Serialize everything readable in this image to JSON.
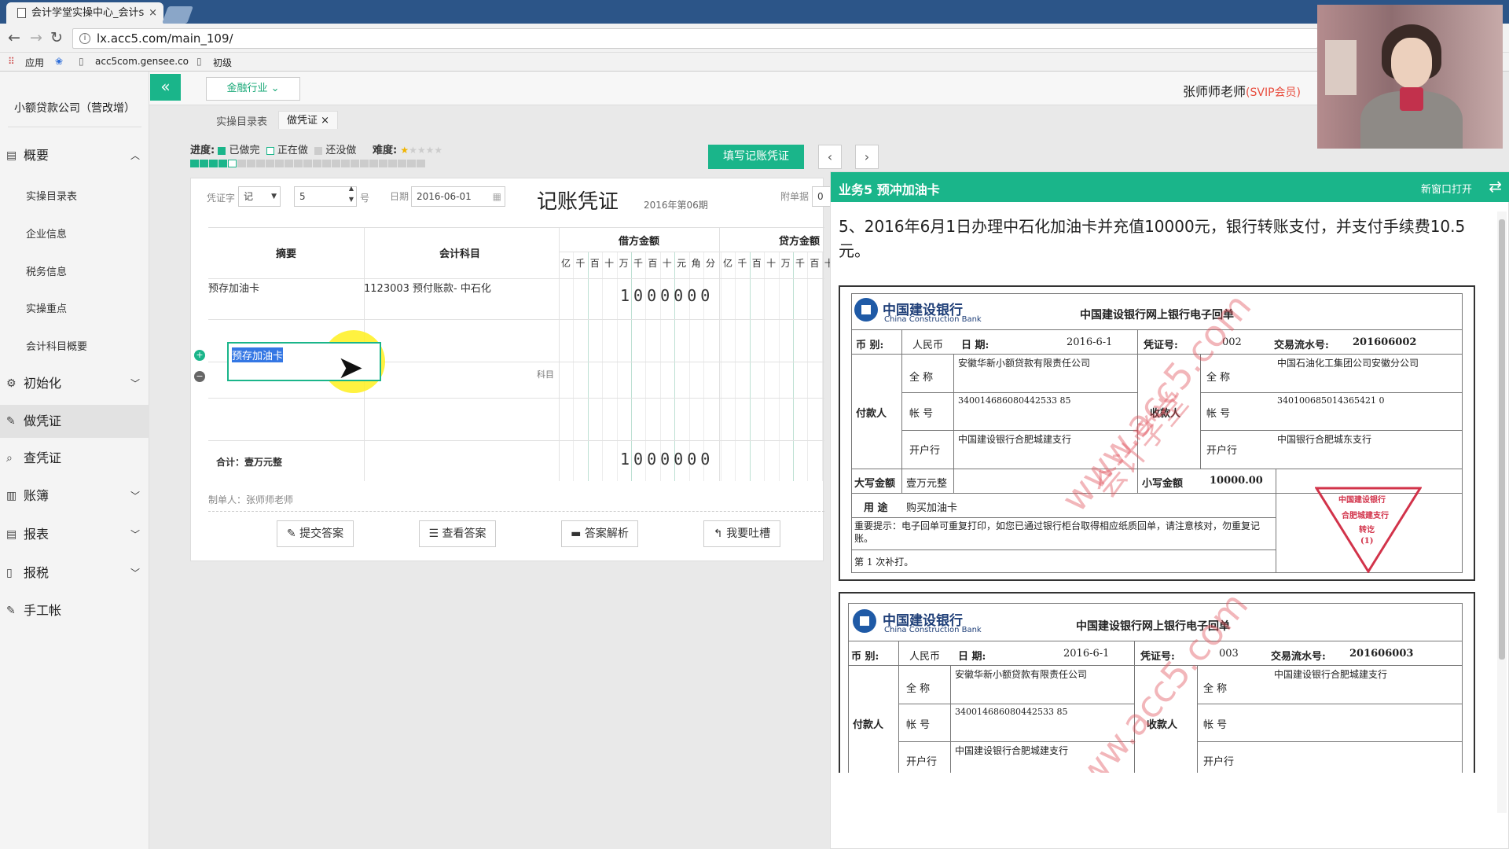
{
  "browser": {
    "tab_title": "会计学堂实操中心_会计s",
    "close": "×",
    "url": "lx.acc5.com/main_109/",
    "bookmarks": [
      "应用",
      "acc5com.gensee.co",
      "初级"
    ]
  },
  "sidebar": {
    "company": "小额贷款公司（营改增）",
    "menu": [
      {
        "label": "概要",
        "icon": "overview-icon"
      },
      {
        "label": "初始化",
        "icon": "gear-icon"
      },
      {
        "label": "做凭证",
        "icon": "pencil-icon"
      },
      {
        "label": "查凭证",
        "icon": "search-icon"
      },
      {
        "label": "账簿",
        "icon": "book-icon"
      },
      {
        "label": "报表",
        "icon": "report-icon"
      },
      {
        "label": "报税",
        "icon": "file-icon"
      },
      {
        "label": "手工帐",
        "icon": "pencil-icon"
      }
    ],
    "sub_items": [
      "实操目录表",
      "企业信息",
      "税务信息",
      "实操重点",
      "会计科目概要"
    ]
  },
  "header": {
    "industry": "金融行业",
    "teacher": "张师师老师",
    "svip": "(SVIP会员)",
    "tabs": [
      "实操目录表",
      "做凭证"
    ],
    "tab_close": "×"
  },
  "progress": {
    "label": "进度:",
    "done": "已做完",
    "doing": "正在做",
    "todo": "还没做",
    "difficulty": "难度:",
    "fill_button": "填写记账凭证",
    "prev": "‹",
    "next": "›"
  },
  "voucher": {
    "word_label": "凭证字",
    "word_value": "记",
    "num_value": "5",
    "num_suffix": "号",
    "date_label": "日期",
    "date_value": "2016-06-01",
    "title": "记账凭证",
    "period": "2016年第06期",
    "attach_label": "附单据",
    "attach_value": "0",
    "col_summary": "摘要",
    "col_account": "会计科目",
    "col_debit": "借方金额",
    "col_credit": "贷方金额",
    "digits": [
      "亿",
      "千",
      "百",
      "十",
      "万",
      "千",
      "百",
      "十",
      "元",
      "角",
      "分"
    ],
    "credit_digits": [
      "亿",
      "千",
      "百",
      "十",
      "万",
      "千",
      "百",
      "十"
    ],
    "row1_summary": "预存加油卡",
    "row1_account": "1123003 预付账款- 中石化",
    "row1_debit": "1000000",
    "row2_editing": "预存加油卡",
    "row2_account_hint": "科目",
    "total_label": "合计：壹万元整",
    "total_debit": "1000000",
    "preparer": "制单人：张师师老师",
    "buttons": [
      "提交答案",
      "查看答案",
      "答案解析",
      "我要吐槽"
    ]
  },
  "task": {
    "title": "业务5 预冲加油卡",
    "new_window": "新窗口打开",
    "description": "5、2016年6月1日办理中石化加油卡并充值10000元，银行转账支付，并支付手续费10.5元。"
  },
  "receipts": [
    {
      "bank": "中国建设银行",
      "bank_en": "China Construction Bank",
      "title": "中国建设银行网上银行电子回单",
      "currency_label": "币 别:",
      "currency": "人民币",
      "date_label": "日 期:",
      "date": "2016-6-1",
      "voucher_label": "凭证号:",
      "voucher_no": "002",
      "txn_label": "交易流水号:",
      "txn_no": "201606002",
      "payer_label": "付款人",
      "payee_label": "收款人",
      "full_name_label": "全 称",
      "account_label": "帐 号",
      "bank_label": "开户行",
      "payer_name": "安徽华新小额贷款有限责任公司",
      "payer_account": "340014686080442533 85",
      "payer_bank": "中国建设银行合肥城建支行",
      "payee_name": "中国石油化工集团公司安徽分公司",
      "payee_account": "340100685014365421 0",
      "payee_bank": "中国银行合肥城东支行",
      "upper_label": "大写金额",
      "upper_amount": "壹万元整",
      "lower_label": "小写金额",
      "lower_amount": "10000.00",
      "purpose_label": "用 途",
      "purpose": "购买加油卡",
      "notice": "重要提示：电子回单可重复打印，如您已通过银行柜台取得相应纸质回单，请注意核对，勿重复记账。",
      "print_count": "第 1 次补打。",
      "stamp_lines": [
        "中国建设银行",
        "合肥城建支行",
        "转讫",
        "(1)"
      ]
    },
    {
      "bank": "中国建设银行",
      "bank_en": "China Construction Bank",
      "title": "中国建设银行网上银行电子回单",
      "currency_label": "币 别:",
      "currency": "人民币",
      "date_label": "日 期:",
      "date": "2016-6-1",
      "voucher_label": "凭证号:",
      "voucher_no": "003",
      "txn_label": "交易流水号:",
      "txn_no": "201606003",
      "payer_label": "付款人",
      "payee_label": "收款人",
      "full_name_label": "全 称",
      "account_label": "帐 号",
      "bank_label": "开户行",
      "payer_name": "安徽华新小额贷款有限责任公司",
      "payer_account": "340014686080442533 85",
      "payer_bank": "中国建设银行合肥城建支行",
      "payee_name": "中国建设银行合肥城建支行"
    }
  ],
  "watermark": [
    "www.acc5.com",
    "会计学堂"
  ],
  "colors": {
    "accent": "#1ab58a",
    "tab_bar": "#2c5588",
    "svip": "#e84c3d",
    "stamp": "#d2334a"
  }
}
